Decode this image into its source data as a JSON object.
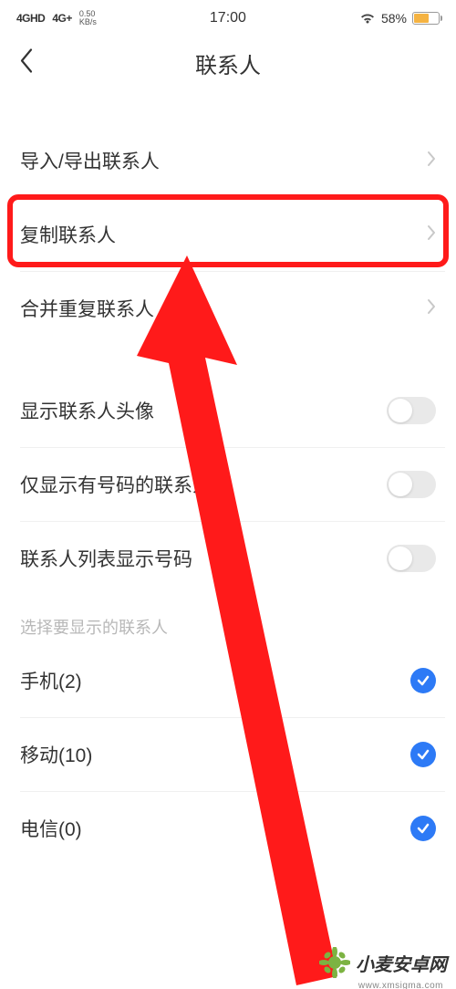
{
  "status": {
    "sig1": "4GHD",
    "sig2": "4G+",
    "speed_top": "0.50",
    "speed_bot": "KB/s",
    "time": "17:00",
    "battery": "58%"
  },
  "nav": {
    "title": "联系人"
  },
  "group1": {
    "row1": "导入/导出联系人",
    "row2": "复制联系人",
    "row3": "合并重复联系人"
  },
  "group2": {
    "row1": "显示联系人头像",
    "row2": "仅显示有号码的联系人",
    "row3": "联系人列表显示号码"
  },
  "section_head": "选择要显示的联系人",
  "group3": {
    "row1": "手机(2)",
    "row2": "移动(10)",
    "row3": "电信(0)"
  },
  "watermark": {
    "text": "小麦安卓网",
    "url": "www.xmsigma.com"
  }
}
